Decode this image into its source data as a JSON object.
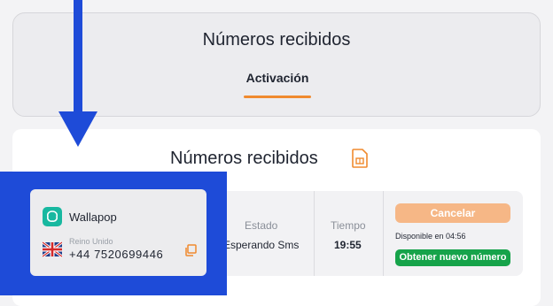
{
  "header": {
    "title": "Números recibidos",
    "tab_label": "Activación"
  },
  "main": {
    "title": "Números recibidos",
    "columns": {
      "estado": {
        "label": "Estado",
        "value": "Esperando Sms"
      },
      "tiempo": {
        "label": "Tiempo",
        "value": "19:55"
      }
    }
  },
  "service": {
    "name": "Wallapop",
    "country": "Reino Unido",
    "phone": "+44 7520699446"
  },
  "actions": {
    "cancel_label": "Cancelar",
    "available_text": "Disponible en 04:56",
    "new_number_label": "Obtener nuevo número"
  },
  "icons": {
    "sim": "sim-card-icon",
    "copy": "copy-icon",
    "service": "wallapop-logo-icon",
    "flag": "uk-flag-icon",
    "arrow": "down-arrow-annotation"
  },
  "colors": {
    "accent": "#f08a2e",
    "cancel": "#f6b786",
    "success": "#16a34a",
    "highlight": "#1e4bd8"
  }
}
